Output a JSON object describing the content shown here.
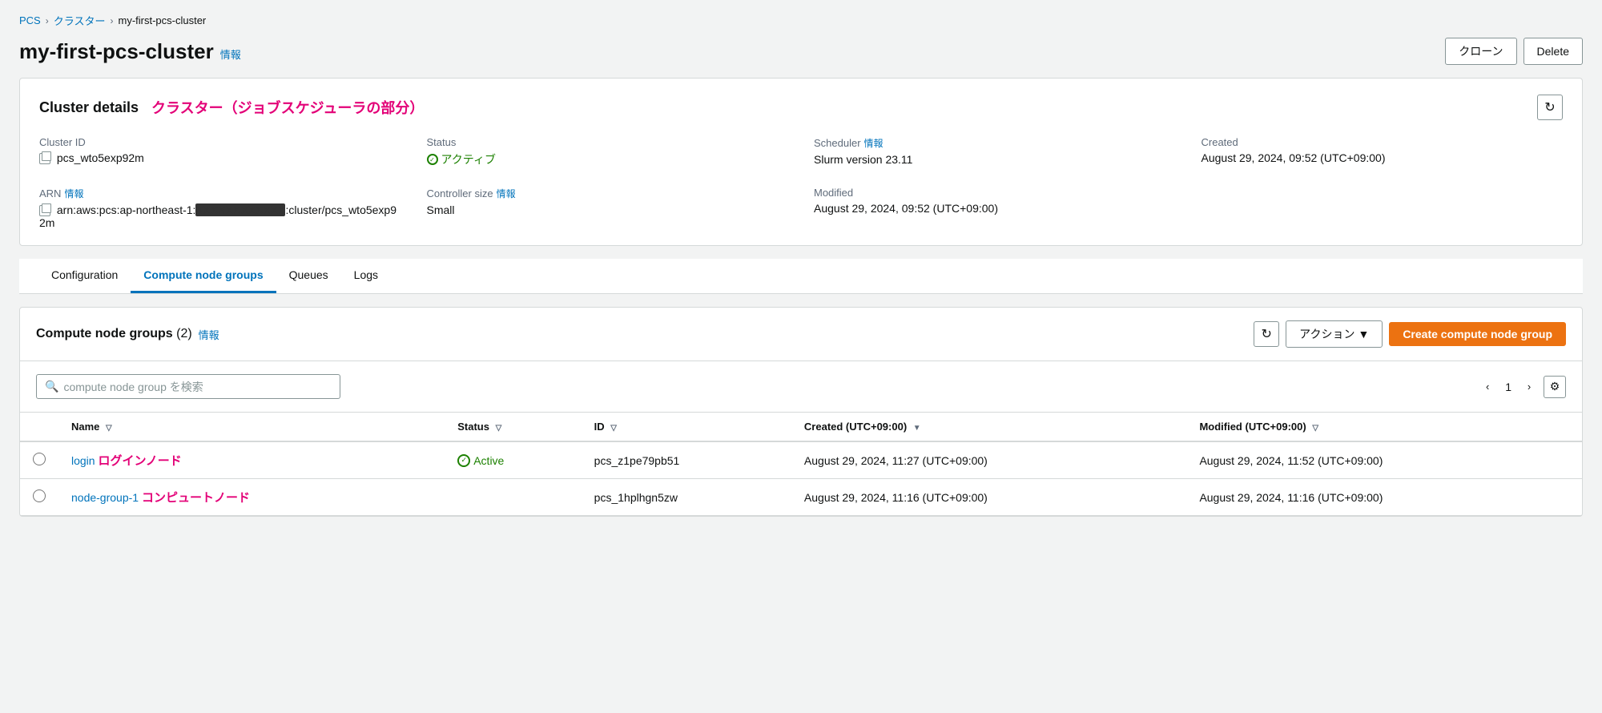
{
  "breadcrumb": {
    "items": [
      {
        "label": "PCS",
        "href": "#"
      },
      {
        "label": "クラスター",
        "href": "#"
      },
      {
        "label": "my-first-pcs-cluster",
        "href": null
      }
    ],
    "separators": [
      ">",
      ">"
    ]
  },
  "pageTitle": "my-first-pcs-cluster",
  "infoLabel": "情報",
  "headerButtons": {
    "clone": "クローン",
    "delete": "Delete"
  },
  "clusterDetails": {
    "cardTitle": "Cluster details",
    "cardSubtitle": "クラスター（ジョブスケジューラの部分）",
    "fields": {
      "clusterId": {
        "label": "Cluster ID",
        "value": "pcs_wto5exp92m"
      },
      "status": {
        "label": "Status",
        "value": "アクティブ",
        "dotted": true
      },
      "scheduler": {
        "label": "Scheduler",
        "infoLabel": "情報",
        "value": "Slurm version 23.11"
      },
      "created": {
        "label": "Created",
        "value": "August 29, 2024, 09:52 (UTC+09:00)"
      },
      "arn": {
        "label": "ARN",
        "infoLabel": "情報",
        "value": "arn:aws:pcs:ap-northeast-1:",
        "maskedPart": "XXXXXXXXXXXX",
        "valueSuffix": ":cluster/pcs_wto5exp92m"
      },
      "controllerSize": {
        "label": "Controller size",
        "infoLabel": "情報",
        "value": "Small"
      },
      "modified": {
        "label": "Modified",
        "value": "August 29, 2024, 09:52 (UTC+09:00)"
      }
    }
  },
  "tabs": [
    {
      "label": "Configuration",
      "id": "configuration"
    },
    {
      "label": "Compute node groups",
      "id": "compute-node-groups",
      "active": true
    },
    {
      "label": "Queues",
      "id": "queues"
    },
    {
      "label": "Logs",
      "id": "logs"
    }
  ],
  "computeNodeGroups": {
    "title": "Compute node groups",
    "count": "2",
    "infoLabel": "情報",
    "buttons": {
      "refresh": "↻",
      "actions": "アクション",
      "create": "Create compute node group"
    },
    "search": {
      "placeholder": "compute node group を検索"
    },
    "pagination": {
      "current": "1",
      "prevDisabled": true,
      "nextDisabled": false
    },
    "columns": [
      {
        "label": "",
        "id": "radio"
      },
      {
        "label": "Name",
        "id": "name",
        "sortable": true
      },
      {
        "label": "Status",
        "id": "status",
        "sortable": true
      },
      {
        "label": "ID",
        "id": "id",
        "sortable": true
      },
      {
        "label": "Created (UTC+09:00)",
        "id": "created",
        "sortable": true,
        "activeSorted": true
      },
      {
        "label": "Modified (UTC+09:00)",
        "id": "modified",
        "sortable": true
      }
    ],
    "rows": [
      {
        "id": "row-1",
        "name": "login",
        "nameAnnotation": "ログインノード",
        "statusText": "Active",
        "statusActive": true,
        "nodeId": "pcs_z1pe79pb51",
        "created": "August 29, 2024, 11:27 (UTC+09:00)",
        "modified": "August 29, 2024, 11:52 (UTC+09:00)"
      },
      {
        "id": "row-2",
        "name": "node-group-1",
        "nameAnnotation": "コンピュートノード",
        "statusText": "",
        "statusActive": false,
        "nodeId": "pcs_1hplhgn5zw",
        "created": "August 29, 2024, 11:16 (UTC+09:00)",
        "modified": "August 29, 2024, 11:16 (UTC+09:00)"
      }
    ]
  }
}
